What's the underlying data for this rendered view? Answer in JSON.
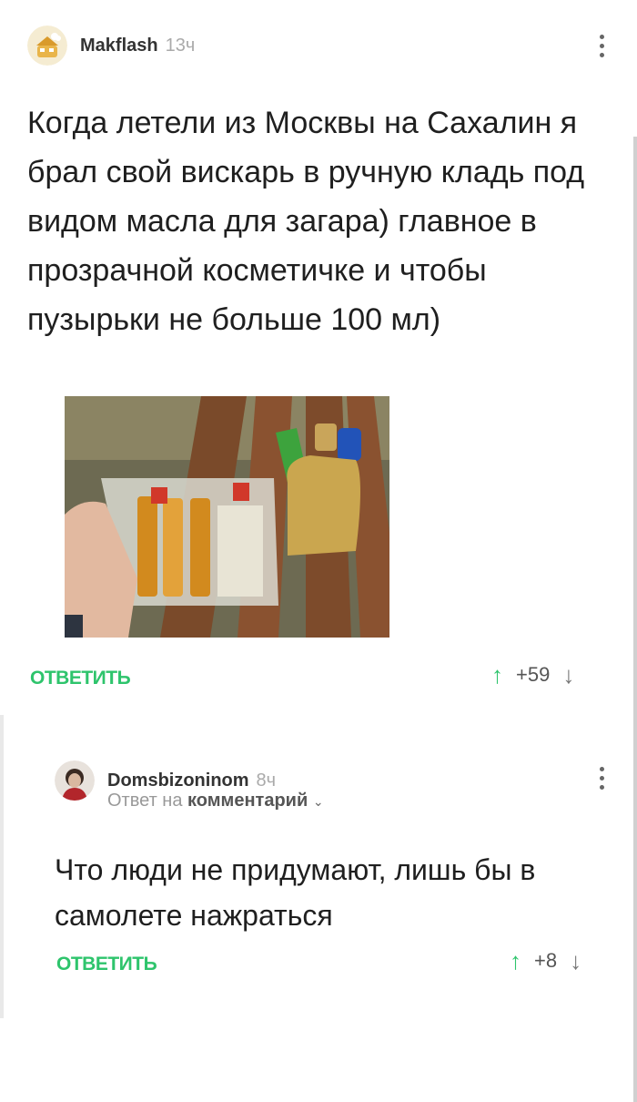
{
  "comment1": {
    "author": "Makflash",
    "time": "13ч",
    "text": "Когда летели из Москвы на Сахалин я брал свой вискарь в ручную кладь под видом масла для загара) главное в прозрачной косметичке и чтобы пузырьки не больше 100 мл)",
    "reply_label": "ОТВЕТИТЬ",
    "score": "+59",
    "up_arrow": "↑",
    "down_arrow": "↓"
  },
  "comment2": {
    "author": "Domsbizoninom",
    "time": "8ч",
    "reply_prefix": "Ответ на",
    "reply_target": "комментарий",
    "text": "Что люди не придумают, лишь бы в самолете нажраться",
    "reply_label": "ОТВЕТИТЬ",
    "score": "+8",
    "up_arrow": "↑",
    "down_arrow": "↓"
  },
  "colors": {
    "accent_green": "#2ec46c",
    "muted_gray": "#aaaaaa"
  },
  "icons": {
    "menu": "more-vertical-icon",
    "upvote": "arrow-up-icon",
    "downvote": "arrow-down-icon",
    "chevron": "chevron-down-icon"
  }
}
